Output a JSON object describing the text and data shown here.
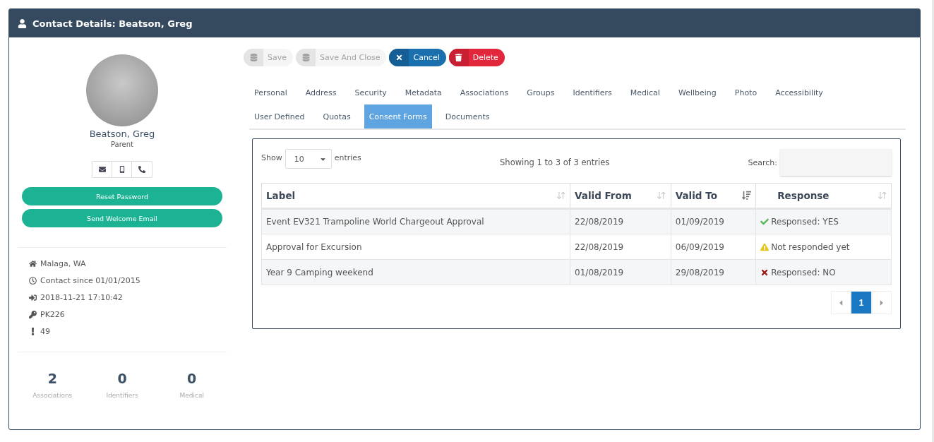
{
  "window": {
    "title": "Contact Details: Beatson, Greg"
  },
  "profile": {
    "name": "Beatson, Greg",
    "role": "Parent",
    "actions": [
      "Reset Password",
      "Send Welcome Email"
    ],
    "details": [
      {
        "kind": "home",
        "text": "Malaga, WA"
      },
      {
        "kind": "clock",
        "text": "Contact since 01/01/2015"
      },
      {
        "kind": "login",
        "text": "2018-11-21 17:10:42"
      },
      {
        "kind": "key",
        "text": "PK226"
      },
      {
        "kind": "alert",
        "text": "49"
      }
    ],
    "stats": [
      {
        "value": "2",
        "label": "Associations"
      },
      {
        "value": "0",
        "label": "Identifiers"
      },
      {
        "value": "0",
        "label": "Medical"
      }
    ]
  },
  "toolbar": [
    {
      "kind": "save",
      "label": "Save",
      "disabled": true
    },
    {
      "kind": "save",
      "label": "Save And Close",
      "disabled": true
    },
    {
      "kind": "cancel",
      "label": "Cancel",
      "disabled": false
    },
    {
      "kind": "delete",
      "label": "Delete",
      "disabled": false
    }
  ],
  "tabs": [
    [
      {
        "label": "Personal",
        "selected": false
      },
      {
        "label": "Address",
        "selected": false
      },
      {
        "label": "Security",
        "selected": false
      },
      {
        "label": "Metadata",
        "selected": false
      },
      {
        "label": "Associations",
        "selected": false
      },
      {
        "label": "Groups",
        "selected": false
      },
      {
        "label": "Identifiers",
        "selected": false
      },
      {
        "label": "Medical",
        "selected": false
      },
      {
        "label": "Wellbeing",
        "selected": false
      },
      {
        "label": "Photo",
        "selected": false
      },
      {
        "label": "Accessibility",
        "selected": false
      }
    ],
    [
      {
        "label": "User Defined",
        "selected": false
      },
      {
        "label": "Quotas",
        "selected": false
      },
      {
        "label": "Consent Forms",
        "selected": true
      },
      {
        "label": "Documents",
        "selected": false
      }
    ]
  ],
  "table": {
    "show_label": "Show",
    "page_size": "10",
    "entries_label": "entries",
    "info": "Showing 1 to 3 of 3 entries",
    "search_label": "Search:",
    "columns": [
      {
        "label": "Label",
        "sorted": false
      },
      {
        "label": "Valid From",
        "sorted": false
      },
      {
        "label": "Valid To",
        "sorted": true
      },
      {
        "label": "Response",
        "sorted": false
      }
    ],
    "rows": [
      {
        "label": "Event EV321 Trampoline World Chargeout Approval",
        "valid_from": "22/08/2019",
        "valid_to": "01/09/2019",
        "response": {
          "kind": "yes",
          "text": "Responsed: YES"
        }
      },
      {
        "label": "Approval for Excursion",
        "valid_from": "22/08/2019",
        "valid_to": "06/09/2019",
        "response": {
          "kind": "pending",
          "text": "Not responded yet"
        }
      },
      {
        "label": "Year 9 Camping weekend",
        "valid_from": "01/08/2019",
        "valid_to": "29/08/2019",
        "response": {
          "kind": "no",
          "text": "Responsed: NO"
        }
      }
    ],
    "pages": [
      {
        "label": "1",
        "selected": true
      }
    ]
  }
}
